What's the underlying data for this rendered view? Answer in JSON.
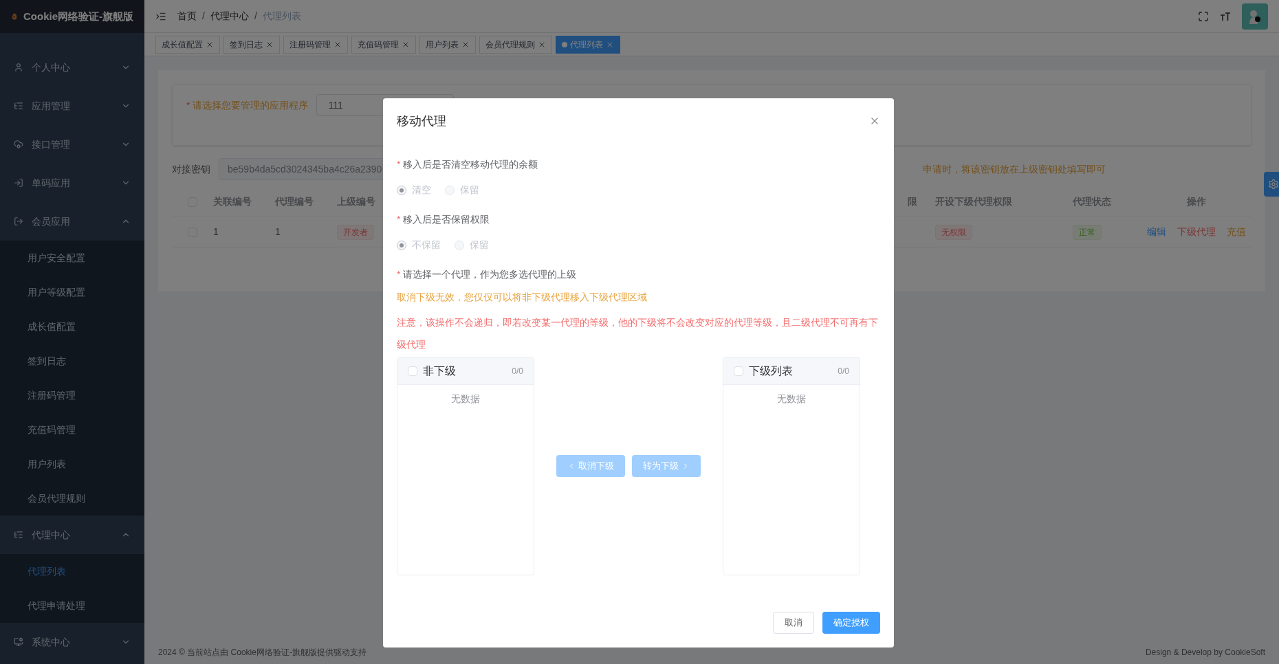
{
  "brand": {
    "title": "Cookie网络验证-旗舰版"
  },
  "sidebar": {
    "items": [
      {
        "label": "个人中心",
        "expanded": false
      },
      {
        "label": "应用管理",
        "expanded": false
      },
      {
        "label": "接口管理",
        "expanded": false
      },
      {
        "label": "单码应用",
        "expanded": false
      },
      {
        "label": "会员应用",
        "expanded": true,
        "children": [
          {
            "label": "用户安全配置",
            "selected": false
          },
          {
            "label": "用户等级配置",
            "selected": false
          },
          {
            "label": "成长值配置",
            "selected": false
          },
          {
            "label": "签到日志",
            "selected": false
          },
          {
            "label": "注册码管理",
            "selected": false
          },
          {
            "label": "充值码管理",
            "selected": false
          },
          {
            "label": "用户列表",
            "selected": false
          },
          {
            "label": "会员代理规则",
            "selected": false
          }
        ]
      },
      {
        "label": "代理中心",
        "expanded": true,
        "children": [
          {
            "label": "代理列表",
            "selected": true
          },
          {
            "label": "代理申请处理",
            "selected": false
          }
        ]
      },
      {
        "label": "系统中心",
        "expanded": false
      }
    ]
  },
  "breadcrumb": {
    "separator": "/",
    "items": [
      "首页",
      "代理中心",
      "代理列表"
    ]
  },
  "tabs": [
    {
      "label": "成长值配置",
      "selected": false
    },
    {
      "label": "签到日志",
      "selected": false
    },
    {
      "label": "注册码管理",
      "selected": false
    },
    {
      "label": "充值码管理",
      "selected": false
    },
    {
      "label": "用户列表",
      "selected": false
    },
    {
      "label": "会员代理规则",
      "selected": false
    },
    {
      "label": "代理列表",
      "selected": true
    }
  ],
  "required_mark": "*",
  "app_select": {
    "label": "请选择您要管理的应用程序",
    "value": "111"
  },
  "key_row": {
    "label": "对接密钥",
    "value": "be59b4da5cd3024345ba4c26a2390",
    "hint": "申请时，将该密钥放在上级密钥处填写即可"
  },
  "table": {
    "header_checked": false,
    "columns_left": [
      "关联编号",
      "代理编号",
      "上级编号"
    ],
    "columns_right": [
      "限",
      "开设下级代理权限",
      "代理状态",
      "操作"
    ],
    "rows": [
      {
        "checked": false,
        "col_1": "1",
        "col_2": "1",
        "parent_tag": "开发者",
        "permission_tag": "无权限",
        "status_tag": "正常",
        "actions": [
          {
            "label": "编辑",
            "kind": "edit"
          },
          {
            "label": "下级代理",
            "kind": "danger"
          },
          {
            "label": "充值",
            "kind": "warn"
          }
        ]
      }
    ]
  },
  "footer": {
    "left": "2024 © 当前站点由 Cookie网络验证-旗舰版提供驱动支持",
    "right": "Design & Develop by CookieSoft"
  },
  "dialog": {
    "title": "移动代理",
    "questions": [
      {
        "label": "移入后是否清空移动代理的余额",
        "options": [
          {
            "label": "清空",
            "selected": true
          },
          {
            "label": "保留",
            "selected": false
          }
        ]
      },
      {
        "label": "移入后是否保留权限",
        "options": [
          {
            "label": "不保留",
            "selected": true
          },
          {
            "label": "保留",
            "selected": false
          }
        ]
      }
    ],
    "parent_label": "请选择一个代理，作为您多选代理的上级",
    "notice_warn": "取消下级无效，您仅仅可以将非下级代理移入下级代理区域",
    "notice_danger": "注意，该操作不会递归，即若改变某一代理的等级，他的下级将不会改变对应的代理等级，且二级代理不可再有下级代理",
    "transfer": {
      "left": {
        "title": "非下级",
        "count": "0/0",
        "empty": "无数据",
        "checked": false
      },
      "right": {
        "title": "下级列表",
        "count": "0/0",
        "empty": "无数据",
        "checked": false
      },
      "to_left": {
        "label": "取消下级",
        "disabled": true
      },
      "to_right": {
        "label": "转为下级",
        "disabled": true
      }
    },
    "buttons": {
      "cancel": "取消",
      "confirm": "确定授权"
    }
  }
}
